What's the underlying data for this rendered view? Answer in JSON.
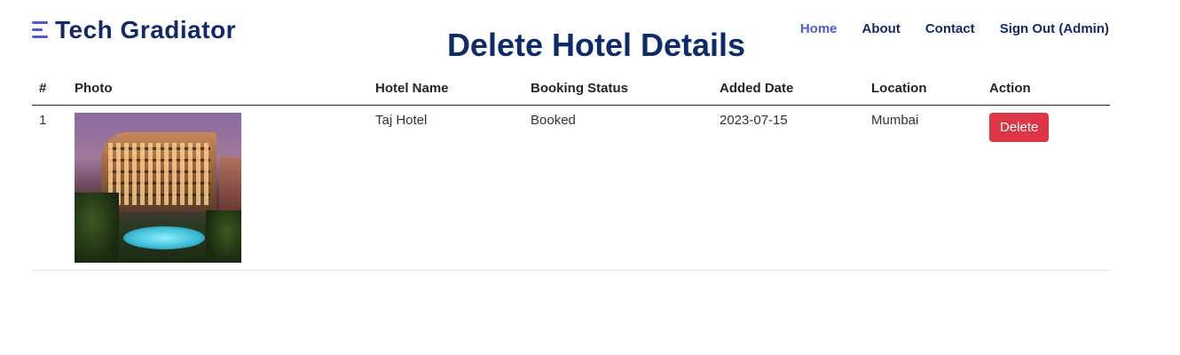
{
  "brand": {
    "name": "Tech Gradiator"
  },
  "nav": {
    "items": [
      {
        "label": "Home",
        "active": true
      },
      {
        "label": "About"
      },
      {
        "label": "Contact"
      },
      {
        "label": "Sign Out (Admin)"
      }
    ]
  },
  "page": {
    "title": "Delete Hotel Details"
  },
  "table": {
    "headers": [
      "#",
      "Photo",
      "Hotel Name",
      "Booking Status",
      "Added Date",
      "Location",
      "Action"
    ],
    "rows": [
      {
        "num": "1",
        "photo_icon": "hotel-photo",
        "hotel_name": "Taj Hotel",
        "booking_status": "Booked",
        "added_date": "2023-07-15",
        "location": "Mumbai",
        "action_label": "Delete"
      }
    ]
  },
  "colors": {
    "brand": "#14296b",
    "accent": "#4f5bd5",
    "title": "#0d2a6b",
    "danger": "#dc3545"
  }
}
